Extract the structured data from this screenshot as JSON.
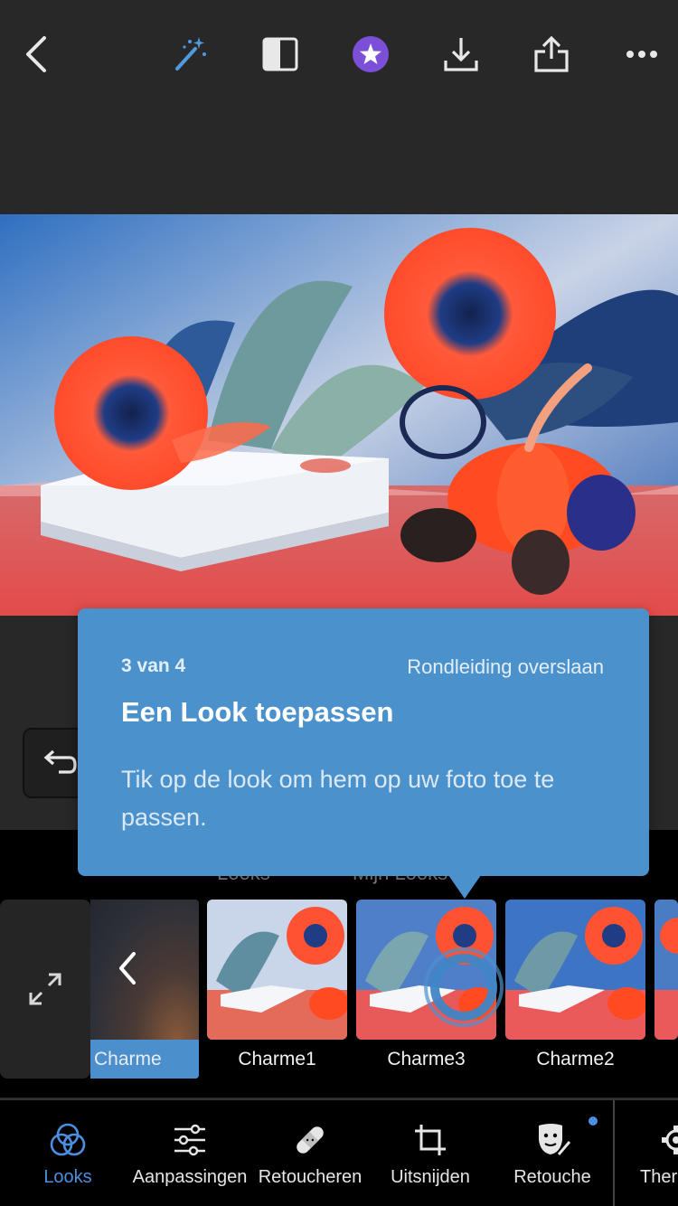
{
  "topbar": {
    "back_icon": "chevron-left-icon",
    "auto_icon": "magic-wand-icon",
    "compare_icon": "compare-icon",
    "premium_icon": "star-badge-icon",
    "download_icon": "download-icon",
    "share_icon": "share-icon",
    "more_icon": "ellipsis-icon"
  },
  "coach": {
    "step": "3 van 4",
    "skip": "Rondleiding overslaan",
    "title": "Een Look toepassen",
    "body": "Tik op de look om hem op uw foto toe te passen."
  },
  "looks": {
    "tabs": [
      "Looks",
      "Mijn Looks"
    ],
    "back_label": "Charme",
    "items": [
      {
        "label": "Charme1"
      },
      {
        "label": "Charme3"
      },
      {
        "label": "Charme2"
      }
    ]
  },
  "bottom_nav": [
    {
      "label": "Looks",
      "icon": "looks-icon",
      "active": true
    },
    {
      "label": "Aanpassingen",
      "icon": "sliders-icon"
    },
    {
      "label": "Retoucheren",
      "icon": "bandage-icon"
    },
    {
      "label": "Uitsnijden",
      "icon": "crop-icon"
    },
    {
      "label": "Retouche",
      "icon": "face-retouch-icon"
    },
    {
      "label": "Ther",
      "icon": "gear-icon"
    }
  ],
  "colors": {
    "accent": "#4b92cd",
    "active_nav": "#4b8fe0",
    "background": "#282828"
  }
}
